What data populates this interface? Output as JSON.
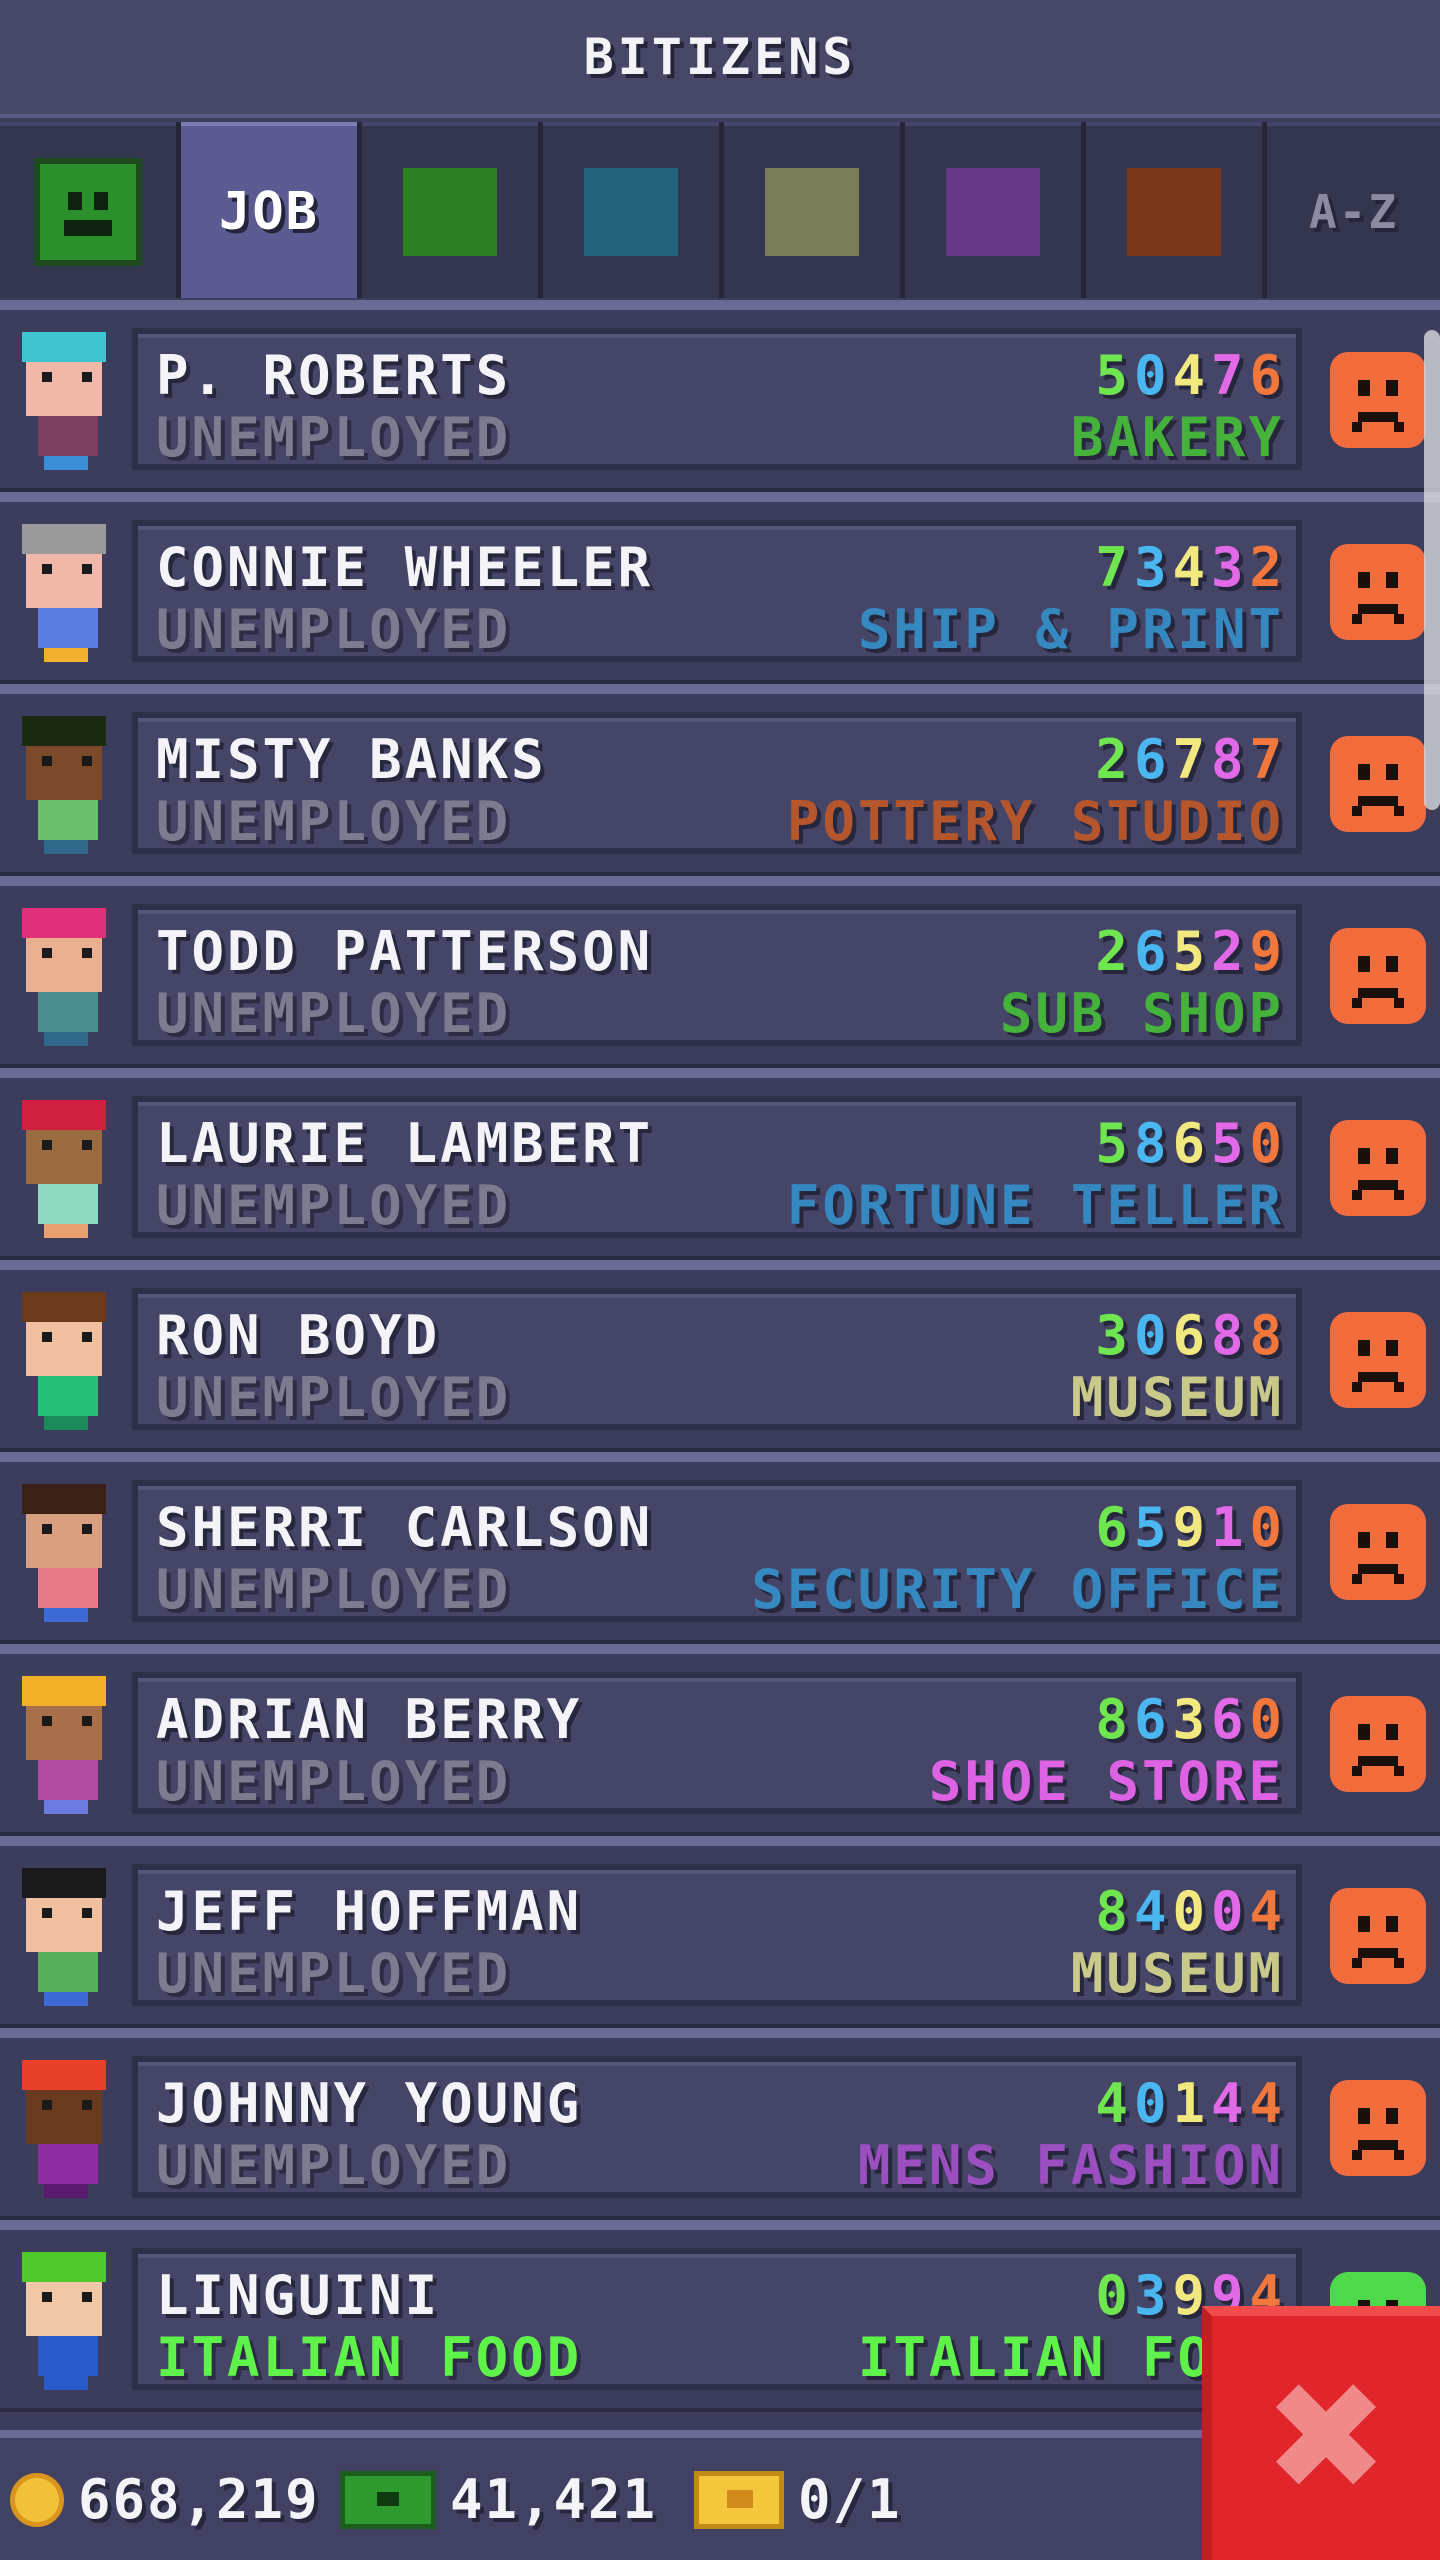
{
  "header": {
    "title": "BITIZENS"
  },
  "tabs": [
    {
      "kind": "icon",
      "icon": "smiley-face-icon",
      "color": "#2b8f2b"
    },
    {
      "kind": "text",
      "label": "JOB",
      "active": true
    },
    {
      "kind": "swatch",
      "name": "food-category-swatch",
      "color": "#2f7f24"
    },
    {
      "kind": "swatch",
      "name": "service-category-swatch",
      "color": "#25627e"
    },
    {
      "kind": "swatch",
      "name": "recreation-category-swatch",
      "color": "#7a7d57"
    },
    {
      "kind": "swatch",
      "name": "retail-category-swatch",
      "color": "#663a86"
    },
    {
      "kind": "swatch",
      "name": "creative-category-swatch",
      "color": "#7a3618"
    },
    {
      "kind": "text",
      "label": "A-Z",
      "active": false
    }
  ],
  "stat_colors": [
    "#6fe64f",
    "#4ab7f0",
    "#f2e880",
    "#e26ae8",
    "#f2773c"
  ],
  "bitizens": [
    {
      "name": "P. ROBERTS",
      "job": "UNEMPLOYED",
      "stats": [
        "5",
        "0",
        "4",
        "7",
        "6"
      ],
      "dream_job": "BAKERY",
      "dream_color": "#45b23b",
      "mood": "sad-face-icon"
    },
    {
      "name": "CONNIE WHEELER",
      "job": "UNEMPLOYED",
      "stats": [
        "7",
        "3",
        "4",
        "3",
        "2"
      ],
      "dream_job": "SHIP & PRINT",
      "dream_color": "#3688c0",
      "mood": "sad-face-icon"
    },
    {
      "name": "MISTY BANKS",
      "job": "UNEMPLOYED",
      "stats": [
        "2",
        "6",
        "7",
        "8",
        "7"
      ],
      "dream_job": "POTTERY STUDIO",
      "dream_color": "#b5562d",
      "mood": "sad-face-icon"
    },
    {
      "name": "TODD PATTERSON",
      "job": "UNEMPLOYED",
      "stats": [
        "2",
        "6",
        "5",
        "2",
        "9"
      ],
      "dream_job": "SUB SHOP",
      "dream_color": "#45b23b",
      "mood": "sad-face-icon"
    },
    {
      "name": "LAURIE LAMBERT",
      "job": "UNEMPLOYED",
      "stats": [
        "5",
        "8",
        "6",
        "5",
        "0"
      ],
      "dream_job": "FORTUNE TELLER",
      "dream_color": "#3688c0",
      "mood": "sad-face-icon"
    },
    {
      "name": "RON BOYD",
      "job": "UNEMPLOYED",
      "stats": [
        "3",
        "0",
        "6",
        "8",
        "8"
      ],
      "dream_job": "MUSEUM",
      "dream_color": "#c9c98a",
      "mood": "sad-face-icon"
    },
    {
      "name": "SHERRI CARLSON",
      "job": "UNEMPLOYED",
      "stats": [
        "6",
        "5",
        "9",
        "1",
        "0"
      ],
      "dream_job": "SECURITY OFFICE",
      "dream_color": "#3688c0",
      "mood": "sad-face-icon"
    },
    {
      "name": "ADRIAN BERRY",
      "job": "UNEMPLOYED",
      "stats": [
        "8",
        "6",
        "3",
        "6",
        "0"
      ],
      "dream_job": "SHOE STORE",
      "dream_color": "#de62e4",
      "mood": "sad-face-icon"
    },
    {
      "name": "JEFF HOFFMAN",
      "job": "UNEMPLOYED",
      "stats": [
        "8",
        "4",
        "0",
        "0",
        "4"
      ],
      "dream_job": "MUSEUM",
      "dream_color": "#c9c98a",
      "mood": "sad-face-icon"
    },
    {
      "name": "JOHNNY YOUNG",
      "job": "UNEMPLOYED",
      "stats": [
        "4",
        "0",
        "1",
        "4",
        "4"
      ],
      "dream_job": "MENS FASHION",
      "dream_color": "#9b4fc0",
      "mood": "sad-face-icon"
    },
    {
      "name": "LINGUINI",
      "job": "ITALIAN FOOD",
      "employed": true,
      "stats": [
        "0",
        "3",
        "9",
        "9",
        "4"
      ],
      "dream_job": "ITALIAN FOOD",
      "dream_color": "#5ef24a",
      "mood": "happy-face-icon"
    }
  ],
  "avatars": [
    {
      "hair": "#3ec5cf",
      "skin": "#f0b8a8",
      "body": "#7a3f5c",
      "legs": "#3b8fd6"
    },
    {
      "hair": "#9a9a9a",
      "skin": "#f0b8a8",
      "body": "#5a7ee0",
      "legs": "#f2b030"
    },
    {
      "hair": "#1d2a12",
      "skin": "#7a4a2a",
      "body": "#6abf6a",
      "legs": "#2f6a8a"
    },
    {
      "hair": "#e0307a",
      "skin": "#e8b090",
      "body": "#4a8e8e",
      "legs": "#2f6a8a"
    },
    {
      "hair": "#d02040",
      "skin": "#9a6a40",
      "body": "#8ed8c0",
      "legs": "#e8a070"
    },
    {
      "hair": "#6a3a1a",
      "skin": "#f0c0a0",
      "body": "#25c07a",
      "legs": "#1d8a5a"
    },
    {
      "hair": "#3a2016",
      "skin": "#d8a080",
      "body": "#e87a8a",
      "legs": "#3b6ad6"
    },
    {
      "hair": "#f2b028",
      "skin": "#a8704a",
      "body": "#b04aa0",
      "legs": "#6a7ae0"
    },
    {
      "hair": "#1a1a1a",
      "skin": "#f0c0a0",
      "body": "#58b05a",
      "legs": "#3b6ad6"
    },
    {
      "hair": "#e8402a",
      "skin": "#6a3a20",
      "body": "#8a2ea0",
      "legs": "#5a1a70"
    },
    {
      "hair": "#4ec82a",
      "skin": "#f0c8a8",
      "body": "#2a5ac8",
      "legs": "#2a5ac8"
    }
  ],
  "footer": {
    "coins": "668,219",
    "bux": "41,421",
    "tickets": "0/1"
  }
}
